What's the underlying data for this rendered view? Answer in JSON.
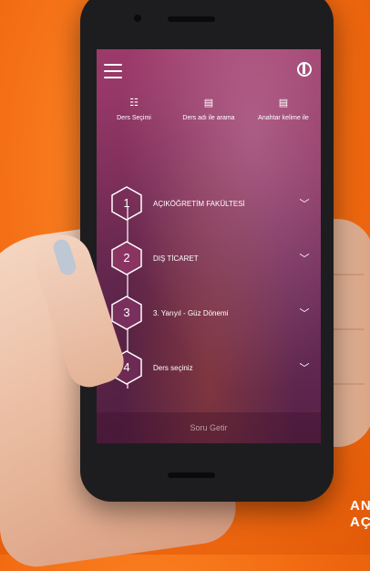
{
  "header": {
    "menu_icon": "hamburger-icon",
    "power_icon": "power-icon"
  },
  "tabs": [
    {
      "label": "Ders Seçimi",
      "icon": "list-icon"
    },
    {
      "label": "Ders adı ile arama",
      "icon": "book-search-icon"
    },
    {
      "label": "Anahtar kelime ile",
      "icon": "keyword-search-icon"
    }
  ],
  "steps": [
    {
      "number": "1",
      "label": "AÇIKÖĞRETİM FAKÜLTESİ"
    },
    {
      "number": "2",
      "label": "DIŞ TİCARET"
    },
    {
      "number": "3",
      "label": "3. Yarıyıl - Güz Dönemi"
    },
    {
      "number": "4",
      "label": "Ders seçiniz"
    }
  ],
  "submit_label": "Soru Getir",
  "side_text": [
    "AN",
    "AÇ"
  ],
  "colors": {
    "background": "#f26b12",
    "screen": "#8a3462"
  }
}
